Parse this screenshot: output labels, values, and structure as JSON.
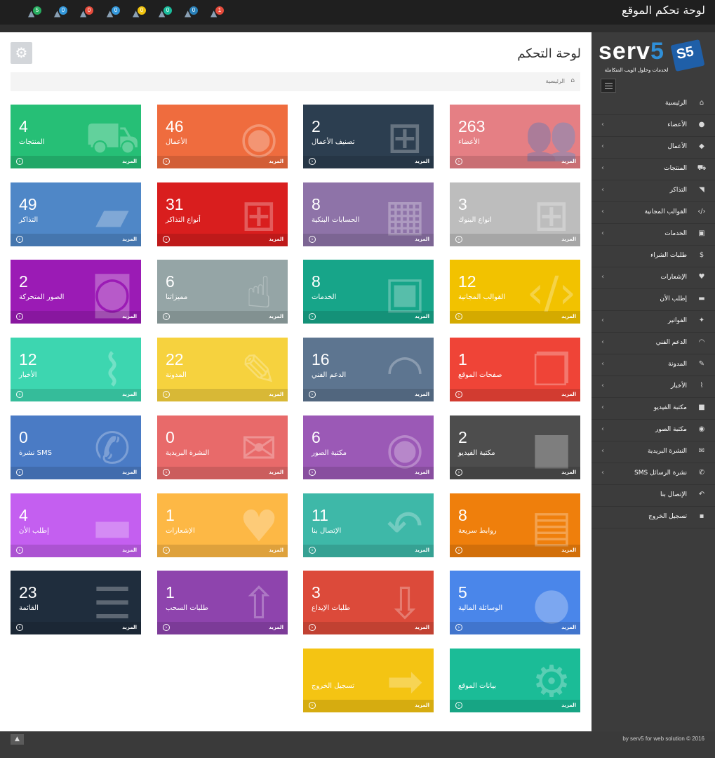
{
  "header": {
    "site_title": "لوحة تحكم الموقع",
    "notifications": [
      {
        "icon": "ticket-icon",
        "count": "5",
        "badge_color": "#27ae60"
      },
      {
        "icon": "user-plus-icon",
        "count": "0",
        "badge_color": "#3498db"
      },
      {
        "icon": "truck-icon",
        "count": "0",
        "badge_color": "#e74c3c"
      },
      {
        "icon": "shopping-cart-icon",
        "count": "0",
        "badge_color": "#3498db"
      },
      {
        "icon": "tag-icon",
        "count": "0",
        "badge_color": "#f1c40f"
      },
      {
        "icon": "users-icon",
        "count": "0",
        "badge_color": "#1abc9c"
      },
      {
        "icon": "envelope-icon",
        "count": "0",
        "badge_color": "#2980b9"
      },
      {
        "icon": "credit-card-icon",
        "count": "1",
        "badge_color": "#e74c3c"
      }
    ]
  },
  "sidebar": {
    "logo": {
      "main": "serv",
      "accent": "5",
      "badge": "S5",
      "tagline": "لخدمات وحلول الويب المتكاملة"
    },
    "items": [
      {
        "label": "الرئيسية",
        "icon": "home-icon",
        "glyph": "⌂",
        "has_sub": false
      },
      {
        "label": "الأعضاء",
        "icon": "user-icon",
        "glyph": "●",
        "has_sub": true
      },
      {
        "label": "الأعمال",
        "icon": "android-icon",
        "glyph": "◆",
        "has_sub": true
      },
      {
        "label": "المنتجات",
        "icon": "shopping-cart-icon",
        "glyph": "⛟",
        "has_sub": true
      },
      {
        "label": "التذاكر",
        "icon": "tags-icon",
        "glyph": "◥",
        "has_sub": true
      },
      {
        "label": "القوالب المجانية",
        "icon": "code-icon",
        "glyph": "‹/›",
        "has_sub": true
      },
      {
        "label": "الخدمات",
        "icon": "briefcase-icon",
        "glyph": "▣",
        "has_sub": true
      },
      {
        "label": "طلبات الشراء",
        "icon": "dollar-icon",
        "glyph": "$",
        "has_sub": false
      },
      {
        "label": "الإشعارات",
        "icon": "heart-icon",
        "glyph": "♥",
        "has_sub": true
      },
      {
        "label": "إطلب الأن",
        "icon": "truck-icon",
        "glyph": "▬",
        "has_sub": false
      },
      {
        "label": "الفواتير",
        "icon": "twitter-icon",
        "glyph": "✦",
        "has_sub": true
      },
      {
        "label": "الدعم الفني",
        "icon": "headphones-icon",
        "glyph": "◠",
        "has_sub": true
      },
      {
        "label": "المدونة",
        "icon": "edit-icon",
        "glyph": "✎",
        "has_sub": true
      },
      {
        "label": "الأخبار",
        "icon": "paperclip-icon",
        "glyph": "⌇",
        "has_sub": true
      },
      {
        "label": "مكتبة الفيديو",
        "icon": "video-camera-icon",
        "glyph": "■",
        "has_sub": true
      },
      {
        "label": "مكتبة الصور",
        "icon": "camera-icon",
        "glyph": "◉",
        "has_sub": true
      },
      {
        "label": "النشرة البريدية",
        "icon": "envelope-icon",
        "glyph": "✉",
        "has_sub": true
      },
      {
        "label": "نشرة الرسائل SMS",
        "icon": "phone-icon",
        "glyph": "✆",
        "has_sub": true
      },
      {
        "label": "الإتصال بنا",
        "icon": "reply-icon",
        "glyph": "↶",
        "has_sub": false
      },
      {
        "label": "تسجيل الخروج",
        "icon": "lock-icon",
        "glyph": "▪",
        "has_sub": false
      }
    ]
  },
  "main": {
    "title": "لوحة التحكم",
    "breadcrumb": "الرئيسية",
    "more_label": "المزيد",
    "tiles": [
      {
        "num": "263",
        "label": "الأعضاء",
        "color": "#e57f84",
        "icon": "users-icon",
        "glyph": "👥"
      },
      {
        "num": "2",
        "label": "تصنيف الأعمال",
        "color": "#2c3e50",
        "icon": "sitemap-icon",
        "glyph": "⊞"
      },
      {
        "num": "46",
        "label": "الأعمال",
        "color": "#ef6c3e",
        "icon": "android-icon",
        "glyph": "◉"
      },
      {
        "num": "4",
        "label": "المنتجات",
        "color": "#26bf76",
        "icon": "shopping-cart-icon",
        "glyph": "⛟"
      },
      {
        "num": "3",
        "label": "انواع البنوك",
        "color": "#bdbdbd",
        "icon": "sitemap-icon",
        "glyph": "⊞"
      },
      {
        "num": "8",
        "label": "الحسابات البنكية",
        "color": "#8e73a8",
        "icon": "building-icon",
        "glyph": "▦"
      },
      {
        "num": "31",
        "label": "أنواع التذاكر",
        "color": "#d91e1e",
        "icon": "sitemap-icon",
        "glyph": "⊞"
      },
      {
        "num": "49",
        "label": "التذاكر",
        "color": "#4f87c7",
        "icon": "ticket-icon",
        "glyph": "▰"
      },
      {
        "num": "12",
        "label": "القوالب المجانية",
        "color": "#f2c200",
        "icon": "code-icon",
        "glyph": "‹/›"
      },
      {
        "num": "8",
        "label": "الخدمات",
        "color": "#17a589",
        "icon": "briefcase-icon",
        "glyph": "▣"
      },
      {
        "num": "6",
        "label": "مميزاتنا",
        "color": "#95a5a6",
        "icon": "thumbs-up-icon",
        "glyph": "☝"
      },
      {
        "num": "2",
        "label": "الصور المتحركة",
        "color": "#9b1bb5",
        "icon": "camera-icon",
        "glyph": "◙"
      },
      {
        "num": "1",
        "label": "صفحات الموقع",
        "color": "#ef4437",
        "icon": "files-icon",
        "glyph": "❐"
      },
      {
        "num": "16",
        "label": "الدعم الفني",
        "color": "#5d7590",
        "icon": "headphones-icon",
        "glyph": "◠"
      },
      {
        "num": "22",
        "label": "المدونة",
        "color": "#f6d23e",
        "icon": "edit-icon",
        "glyph": "✎"
      },
      {
        "num": "12",
        "label": "الأخبار",
        "color": "#3dd6b0",
        "icon": "paperclip-icon",
        "glyph": "⌇"
      },
      {
        "num": "2",
        "label": "مكتبة الفيديو",
        "color": "#4d4d4d",
        "icon": "video-camera-icon",
        "glyph": "■"
      },
      {
        "num": "6",
        "label": "مكتبة الصور",
        "color": "#9b59b6",
        "icon": "camera-icon",
        "glyph": "◉"
      },
      {
        "num": "0",
        "label": "النشرة البريدية",
        "color": "#e86a6a",
        "icon": "envelope-icon",
        "glyph": "✉"
      },
      {
        "num": "0",
        "label": "نشرة SMS",
        "color": "#4a7bc5",
        "icon": "phone-icon",
        "glyph": "✆"
      },
      {
        "num": "8",
        "label": "روابط سريعة",
        "color": "#ef7f0c",
        "icon": "save-icon",
        "glyph": "▤"
      },
      {
        "num": "11",
        "label": "الإتصال بنا",
        "color": "#3eb8a8",
        "icon": "reply-all-icon",
        "glyph": "↶"
      },
      {
        "num": "1",
        "label": "الإشعارات",
        "color": "#fdb845",
        "icon": "heart-icon",
        "glyph": "♥"
      },
      {
        "num": "4",
        "label": "إطلب الأن",
        "color": "#c45ff0",
        "icon": "truck-icon",
        "glyph": "▬"
      },
      {
        "num": "5",
        "label": "الوسائلة المالية",
        "color": "#4a86ea",
        "icon": "apple-icon",
        "glyph": "●"
      },
      {
        "num": "3",
        "label": "طلبات الإيداع",
        "color": "#dc4a3a",
        "icon": "download-icon",
        "glyph": "⇩"
      },
      {
        "num": "1",
        "label": "طلبات السحب",
        "color": "#8e44ad",
        "icon": "upload-icon",
        "glyph": "⇧"
      },
      {
        "num": "23",
        "label": "القائمة",
        "color": "#1f2d3d",
        "icon": "list-icon",
        "glyph": "☰"
      },
      {
        "num": "",
        "label": "بيانات الموقع",
        "color": "#1bbc97",
        "icon": "cogs-icon",
        "glyph": "⚙"
      },
      {
        "num": "",
        "label": "تسجيل الخروج",
        "color": "#f4c413",
        "icon": "sign-out-icon",
        "glyph": "➡"
      }
    ]
  },
  "footer": {
    "copyright": "by serv5 for web solution © 2016"
  }
}
